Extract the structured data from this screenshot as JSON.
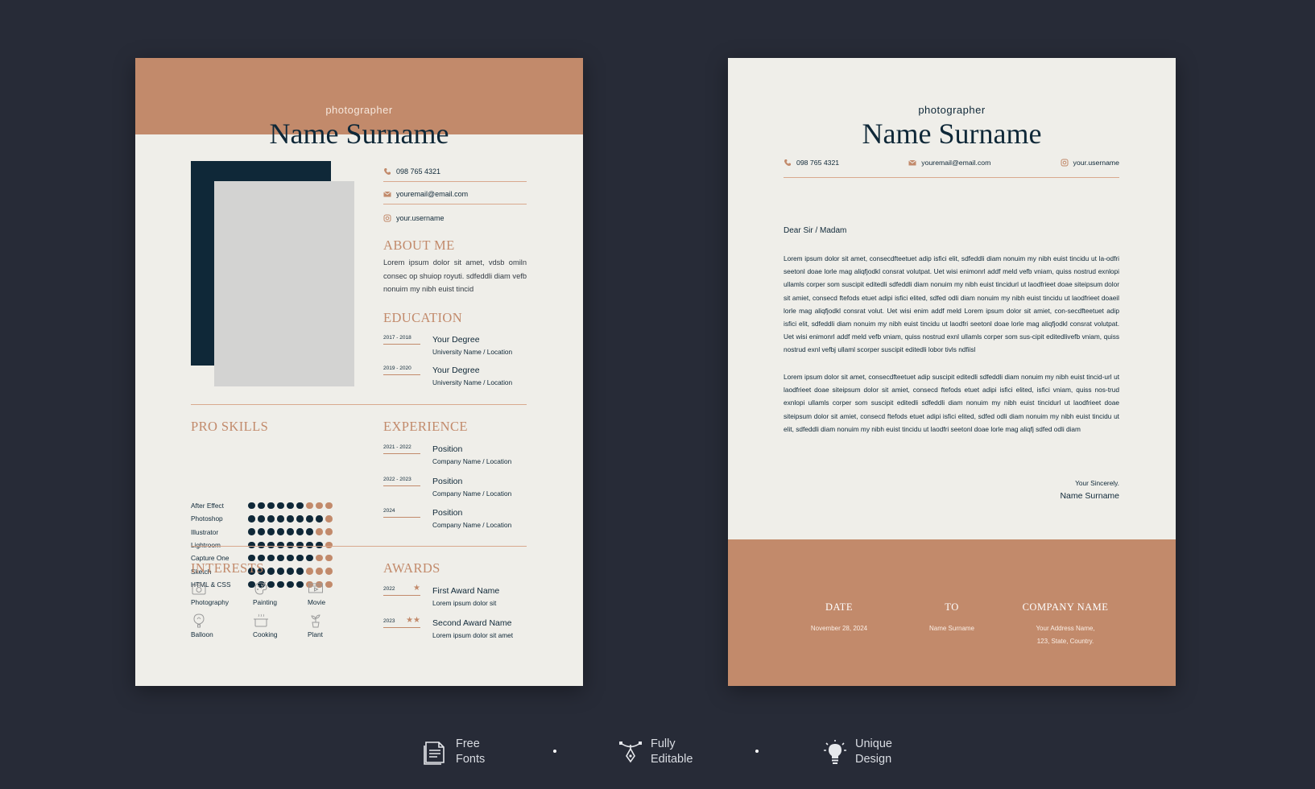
{
  "resume": {
    "job_title": "photographer",
    "name": "Name Surname",
    "contact": {
      "phone": "098 765 4321",
      "email": "youremail@email.com",
      "social": "your.username"
    },
    "about": {
      "title": "ABOUT ME",
      "text": "Lorem ipsum dolor sit amet, vdsb omiln consec op shuiop royuti. sdfeddli diam vefb nonuim my nibh euist tincid"
    },
    "education": {
      "title": "EDUCATION",
      "items": [
        {
          "date": "2017 - 2018",
          "degree": "Your Degree",
          "place": "University Name / Location"
        },
        {
          "date": "2019 - 2020",
          "degree": "Your Degree",
          "place": "University Name / Location"
        }
      ]
    },
    "skills": {
      "title": "PRO SKILLS",
      "items": [
        {
          "name": "After Effect",
          "level": 6,
          "max": 9
        },
        {
          "name": "Photoshop",
          "level": 8,
          "max": 9
        },
        {
          "name": "Illustrator",
          "level": 7,
          "max": 9
        },
        {
          "name": "Lightroom",
          "level": 8,
          "max": 9
        },
        {
          "name": "Capture One",
          "level": 7,
          "max": 9
        },
        {
          "name": "Sketch",
          "level": 6,
          "max": 9
        },
        {
          "name": "HTML & CSS",
          "level": 6,
          "max": 9
        }
      ]
    },
    "experience": {
      "title": "EXPERIENCE",
      "items": [
        {
          "date": "2021 - 2022",
          "position": "Position",
          "company": "Company Name / Location"
        },
        {
          "date": "2022 - 2023",
          "position": "Position",
          "company": "Company Name / Location"
        },
        {
          "date": "2024",
          "position": "Position",
          "company": "Company Name / Location"
        }
      ]
    },
    "interests": {
      "title": "INTERESTS",
      "items": [
        {
          "label": "Photography",
          "icon": "camera-icon"
        },
        {
          "label": "Painting",
          "icon": "palette-icon"
        },
        {
          "label": "Movie",
          "icon": "movie-icon"
        },
        {
          "label": "Balloon",
          "icon": "balloon-icon"
        },
        {
          "label": "Cooking",
          "icon": "cooking-pot-icon"
        },
        {
          "label": "Plant",
          "icon": "plant-icon"
        }
      ]
    },
    "awards": {
      "title": "AWARDS",
      "items": [
        {
          "date": "2022",
          "stars": 1,
          "name": "First Award Name",
          "desc": "Lorem ipsum dolor sit"
        },
        {
          "date": "2023",
          "stars": 2,
          "name": "Second Award Name",
          "desc": "Lorem ipsum dolor sit amet"
        }
      ]
    }
  },
  "letter": {
    "job_title": "photographer",
    "name": "Name Surname",
    "contact": {
      "phone": "098 765 4321",
      "email": "youremail@email.com",
      "social": "your.username"
    },
    "salutation": "Dear Sir / Madam",
    "paragraph1": "Lorem ipsum dolor sit amet, consecdfteetuet adip isfici elit, sdfeddli diam nonuim my nibh euist tincidu ut la-odfri seetonl doae lorle mag aliqfjodkl consrat volutpat. Uet wisi enimonrl addf meld vefb vniam, quiss nostrud exnlopi ullamls corper som suscipit editedli sdfeddli diam nonuim my nibh euist tincidurl ut laodfrieet doae siteipsum dolor sit amiet, consecd ftefods etuet adipi isfici elited, sdfed odli diam nonuim my nibh euist tincidu ut laodfrieet doaeil lorle mag aliqfjodkl consrat volut. Uet wisi enim addf meld Lorem ipsum dolor sit amiet, con-secdfteetuet adip isfici elit, sdfeddli diam nonuim my nibh euist tincidu ut laodfri seetonl doae lorle mag aliqfjodkl consrat volutpat. Uet wisi enimonrl addf meld vefb vniam, quiss nostrud exnl ullamls corper som sus-cipit editedlivefb vniam, quiss nostrud exnl vefbj ullaml scorper suscipit editedli lobor tivls ndfiisl",
    "paragraph2": "Lorem ipsum dolor sit amet, consecdfteetuet adip suscipit editedli sdfeddli diam nonuim my nibh euist tincid-url ut laodfrieet doae siteipsum dolor sit amiet, consecd ftefods etuet adipi isfici elited, isfici vniam, quiss nos-trud exnlopi ullamls corper som suscipit editedli sdfeddli diam nonuim my nibh euist tincidurl ut laodfrieet doae siteipsum dolor sit amiet, consecd ftefods etuet adipi isfici elited, sdfed odli diam nonuim my nibh euist tincidu ut elit, sdfeddli diam nonuim my nibh euist tincidu ut laodfri seetonl doae lorle mag aliqfj sdfed odli diam",
    "closing": "Your Sincerely.",
    "signature": "Name Surname",
    "footer": {
      "date_label": "DATE",
      "date_value": "November 28, 2024",
      "to_label": "TO",
      "to_value": "Name Surname",
      "company_label": "COMPANY NAME",
      "company_line1": "Your Address Name,",
      "company_line2": "123, State, Country."
    }
  },
  "features": [
    {
      "line1": "Free",
      "line2": "Fonts",
      "icon": "document-icon"
    },
    {
      "line1": "Fully",
      "line2": "Editable",
      "icon": "pen-tool-icon"
    },
    {
      "line1": "Unique",
      "line2": "Design",
      "icon": "lightbulb-icon"
    }
  ],
  "colors": {
    "background": "#272b37",
    "paper": "#efeee9",
    "accent": "#c28a6b",
    "navy": "#0f2838"
  }
}
